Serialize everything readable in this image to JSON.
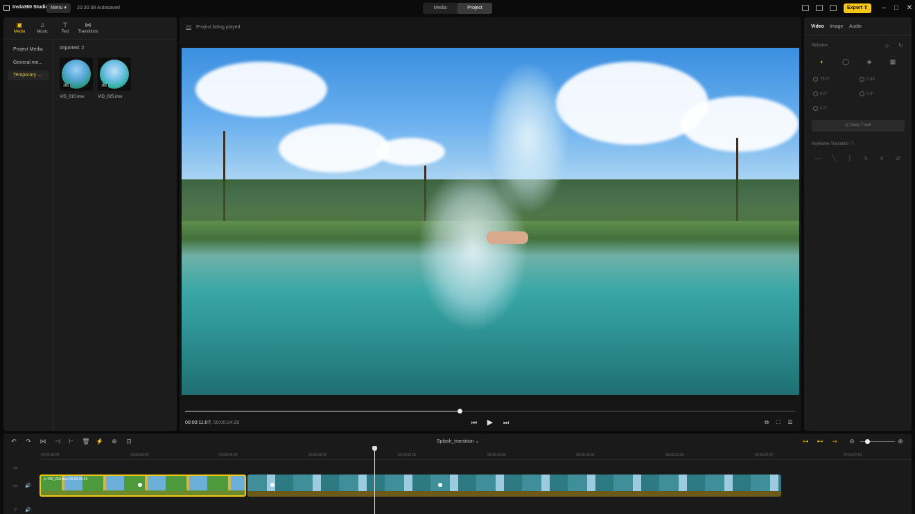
{
  "titlebar": {
    "app_name": "Insta360 Studio",
    "menu_label": "Menu",
    "autosave_text": "20:30:38 Autosaved",
    "modes": [
      "Media",
      "Project"
    ],
    "active_mode": "Project",
    "export_label": "Export"
  },
  "library": {
    "tabs": [
      {
        "label": "Media",
        "icon": "folder-icon"
      },
      {
        "label": "Music",
        "icon": "music-note-icon"
      },
      {
        "label": "Text",
        "icon": "text-icon"
      },
      {
        "label": "Transitions",
        "icon": "transition-icon"
      }
    ],
    "active_tab": "Media",
    "sidebar": [
      "Project Media",
      "General me...",
      "Temporary ..."
    ],
    "active_sidebar": "Temporary ...",
    "imported_label": "Imported: 2",
    "items": [
      {
        "name": "VID_010.insv",
        "badge": "360"
      },
      {
        "name": "VID_025.insv",
        "badge": "360"
      }
    ]
  },
  "viewer": {
    "title": "Project being played",
    "current_time": "00:00:11:07",
    "total_time": "00:00:24:28",
    "progress": 0.45
  },
  "inspector": {
    "tabs": [
      "Video",
      "Image",
      "Audio"
    ],
    "active_tab": "Video",
    "reframe_label": "Reframe",
    "params": {
      "fov": "75.0°",
      "distortion": "0.60",
      "pan": "0.0°",
      "tilt": "0.0°",
      "roll": "0.0°"
    },
    "deep_track_label": "Deep Track",
    "keyframe_label": "Keyframe Transition"
  },
  "timeline": {
    "clip_name": "Splash_transition",
    "ruler_labels": [
      "00:00:00:00",
      "00:00:03:00",
      "00:00:06:00",
      "00:00:09:00",
      "00:00:12:00",
      "00:00:15:00",
      "00:00:18:00",
      "00:00:21:00",
      "00:00:24:00",
      "00:00:27:00"
    ],
    "clip_a_label": "VID_010.insv",
    "clip_a_time": "00:00:06:29",
    "zoom_level": 0.2
  },
  "colors": {
    "accent": "#f5c518",
    "panel": "#1c1c1c",
    "background": "#0b0b0b"
  }
}
